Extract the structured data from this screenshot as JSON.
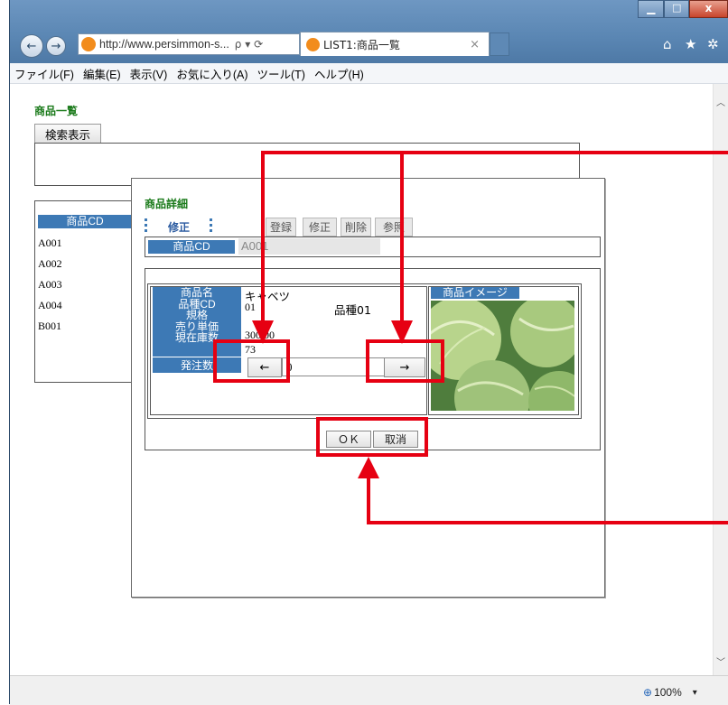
{
  "browser": {
    "url": "http://www.persimmon-s...",
    "address_controls": "ρ ▾ ⟳",
    "tab_title": "LIST1:商品一覧",
    "tab_close": "×",
    "menu": [
      "ファイル(F)",
      "編集(E)",
      "表示(V)",
      "お気に入り(A)",
      "ツール(T)",
      "ヘルプ(H)"
    ],
    "zoom": "100%",
    "zoom_caret": "▾"
  },
  "list_page": {
    "title": "商品一覧",
    "search_button": "検索表示",
    "column_header": "商品CD",
    "rows": [
      "A001",
      "A002",
      "A003",
      "A004",
      "B001"
    ]
  },
  "detail": {
    "title": "商品詳細",
    "mode_label": "修正",
    "buttons": [
      "登録",
      "修正",
      "削除",
      "参照"
    ],
    "code_label": "商品CD",
    "code_value": "A001",
    "fields": {
      "name_label": "商品名",
      "name_value": "キャベツ",
      "variety_label": "品種CD",
      "variety_code": "01",
      "variety_name": "品種01",
      "spec_label": "規格",
      "price_label": "売り単価",
      "price_value": "300.00",
      "stock_label": "現在庫数",
      "stock_value": "73",
      "order_label": "発注数",
      "order_value": "0"
    },
    "left_arrow": "←",
    "right_arrow": "→",
    "image_header": "商品イメージ",
    "ok_button": "ＯＫ",
    "cancel_button": "取消"
  }
}
